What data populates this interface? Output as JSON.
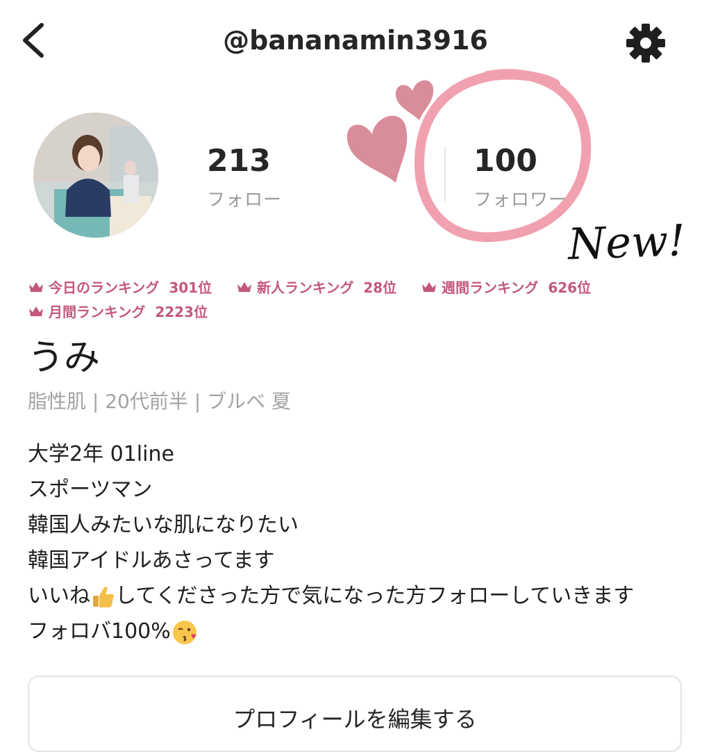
{
  "header": {
    "username": "@bananamin3916",
    "back_icon": "chevron-left-icon",
    "settings_icon": "gear-icon"
  },
  "stats": {
    "following_count": "213",
    "following_label": "フォロー",
    "followers_count": "100",
    "followers_label": "フォロワー"
  },
  "decorations": {
    "new_text": "New!",
    "heart_color": "#d98c9a",
    "circle_color": "#ee8fa2"
  },
  "rankings": [
    {
      "label": "今日のランキング",
      "value": "301位"
    },
    {
      "label": "新人ランキング",
      "value": "28位"
    },
    {
      "label": "週間ランキング",
      "value": "626位"
    },
    {
      "label": "月間ランキング",
      "value": "2223位"
    }
  ],
  "profile": {
    "name": "うみ",
    "meta": "脂性肌 | 20代前半 | ブルベ 夏"
  },
  "bio": {
    "line1": "大学2年  01line",
    "line2": "スポーツマン",
    "line3": "韓国人みたいな肌になりたい",
    "line4": "韓国アイドルあさってます",
    "line5_a": "いいね",
    "line5_b": "してくださった方で気になった方フォローしていきます",
    "line6": "フォロバ100%"
  },
  "edit_button_label": "プロフィールを編集する",
  "colors": {
    "accent_pink": "#c4587a",
    "muted_gray": "#9b9b9b"
  }
}
